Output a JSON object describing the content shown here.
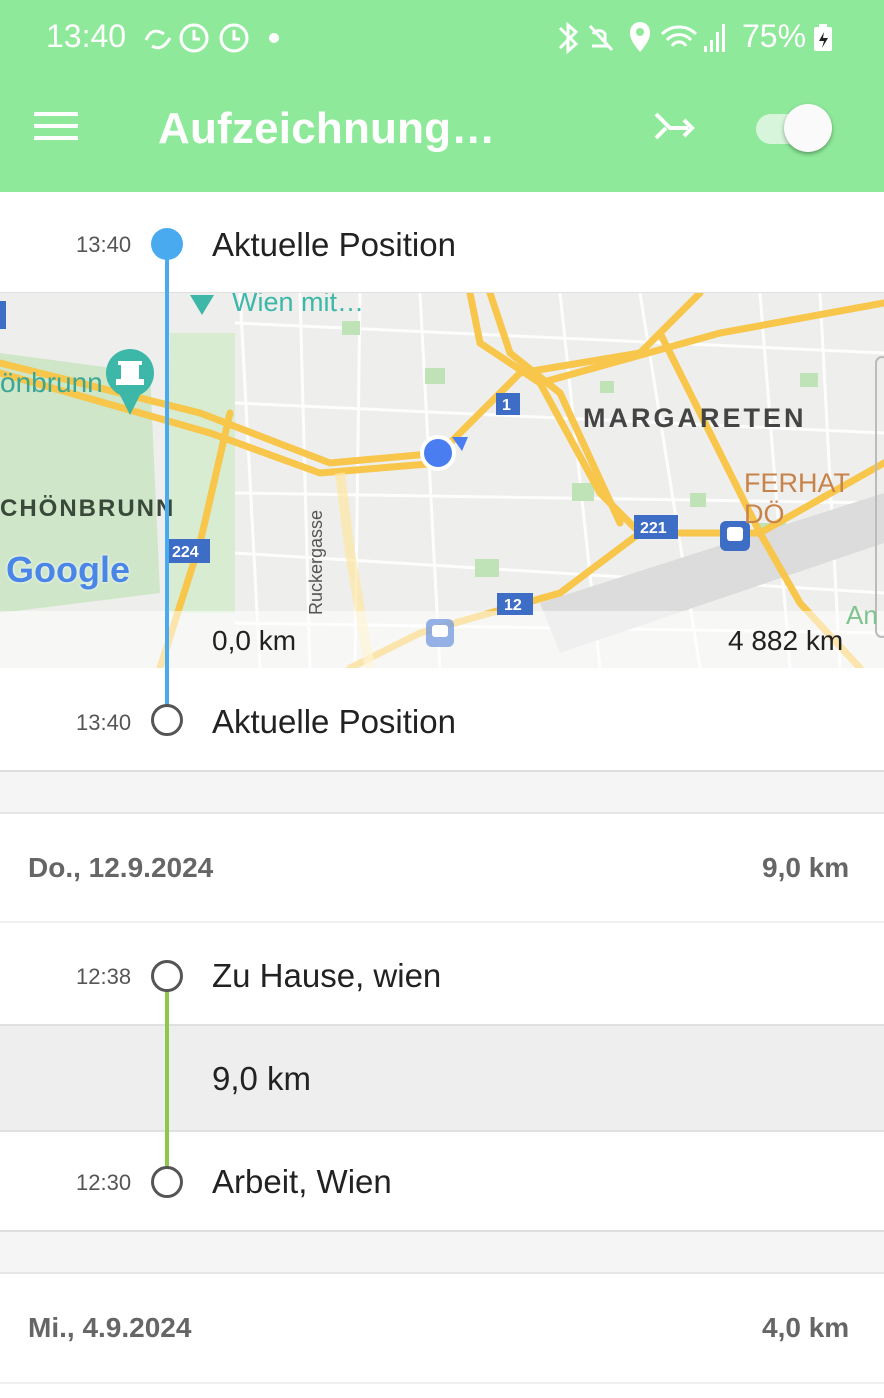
{
  "status_bar": {
    "time": "13:40",
    "battery": "75%",
    "icons_left": [
      "sync-icon",
      "alarm-icon",
      "alarm-icon",
      "dot-icon"
    ],
    "icons_right": [
      "bluetooth-icon",
      "mute-icon",
      "location-icon",
      "wifi-icon",
      "signal-icon"
    ]
  },
  "app_bar": {
    "title": "Aufzeichnung…",
    "menu_icon": "hamburger-icon",
    "route_icon": "shuffle-arrow-icon",
    "recording_switch_on": true,
    "accent": "#8eea9a"
  },
  "current": {
    "start_time": "13:40",
    "start_label": "Aktuelle Position",
    "end_time": "13:40",
    "end_label": "Aktuelle Position",
    "line_color": "#4aaaf0",
    "map": {
      "labels": {
        "wien_mitte": "Wien mit…",
        "schoenbrunn1": "önbrunn",
        "schoenbrunn2": "CHÖNBRUNN",
        "margareten": "MARGARETEN",
        "ferhat": "FERHAT DÖ",
        "ruckergasse": "Ruckergasse",
        "google": "Google",
        "an": "An"
      },
      "road_shields": [
        "1",
        "224",
        "221",
        "12"
      ],
      "dist_left": "0,0 km",
      "dist_right": "4 882 km"
    }
  },
  "days": [
    {
      "date": "Do., 12.9.2024",
      "total": "9,0 km",
      "start_time": "12:38",
      "start_label": "Zu Hause, wien",
      "segment_km": "9,0 km",
      "end_time": "12:30",
      "end_label": "Arbeit, Wien",
      "line_color": "#8cc84b"
    },
    {
      "date": "Mi., 4.9.2024",
      "total": "4,0 km"
    }
  ]
}
